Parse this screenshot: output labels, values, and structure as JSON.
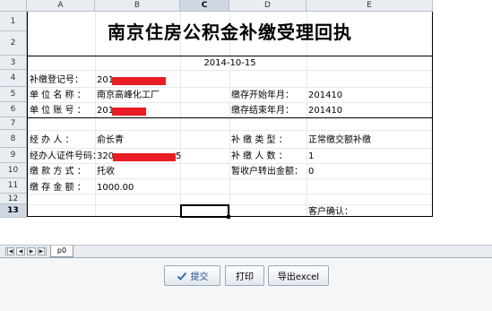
{
  "columns": [
    "A",
    "B",
    "C",
    "D",
    "E"
  ],
  "rows": [
    "1",
    "2",
    "3",
    "4",
    "5",
    "6",
    "7",
    "8",
    "9",
    "10",
    "11",
    "12",
    "13"
  ],
  "active_column": "C",
  "active_row": "13",
  "report": {
    "title": "南京住房公积金补缴受理回执",
    "date": "2014-10-15",
    "reg_no_label": "补缴登记号：",
    "reg_no_value": "201",
    "unit_name_label": "单 位 名 称 ：",
    "unit_name_value": "南京高峰化工厂",
    "unit_account_label": "单 位 账 号 ：",
    "unit_account_value": "201",
    "start_month_label": "缴存开始年月：",
    "start_month_value": "201410",
    "end_month_label": "缴存结束年月：",
    "end_month_value": "201410",
    "handler_label": "经 办 人 ：",
    "handler_value": "俞长青",
    "handler_id_label": "经办人证件号码：",
    "handler_id_value": "320",
    "handler_id_tail": "5",
    "pay_method_label": "缴 款 方 式 ：",
    "pay_method_value": "托收",
    "deposit_amount_label": "缴 存 金 额 ：",
    "deposit_amount_value": "1000.00",
    "supp_type_label": "补 缴 类 型 ：",
    "supp_type_value": "正常缴交额补缴",
    "supp_count_label": "补 缴 人 数 ：",
    "supp_count_value": "1",
    "temp_transfer_label": "暂收户转出金额：",
    "temp_transfer_value": "0",
    "customer_confirm_label": "客户确认："
  },
  "sheet_tabs": [
    "p0"
  ],
  "buttons": {
    "submit": "提交",
    "print": "打印",
    "export": "导出excel"
  },
  "colors": {
    "redaction": "#ea1c24",
    "accent": "#1d4f8a"
  }
}
